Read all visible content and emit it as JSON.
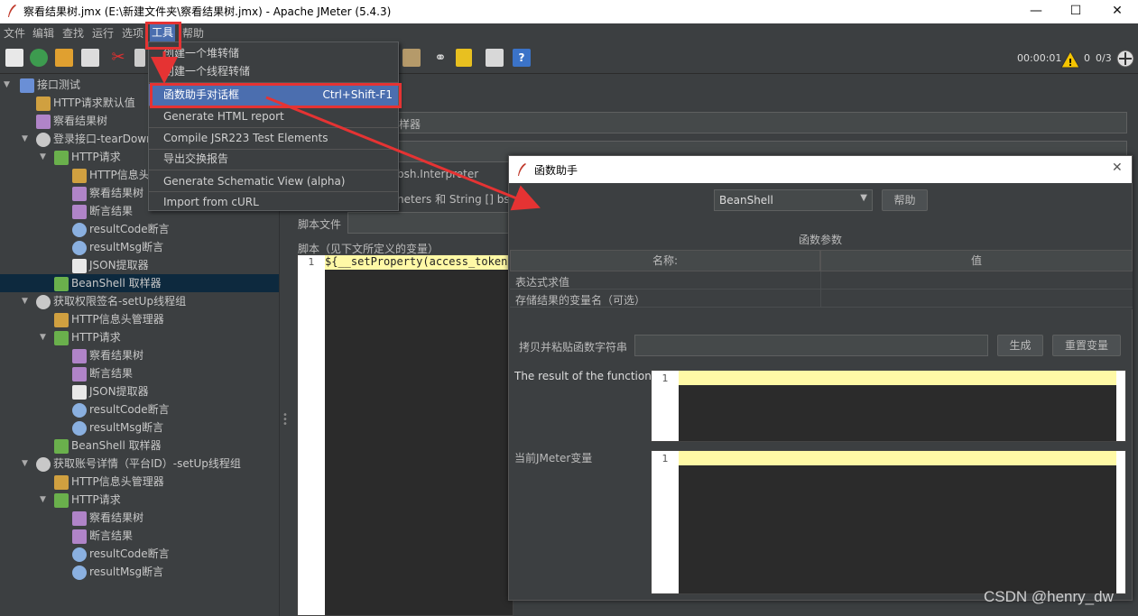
{
  "window": {
    "title": "察看结果树.jmx (E:\\新建文件夹\\察看结果树.jmx) - Apache JMeter (5.4.3)",
    "min_glyph": "—",
    "max_glyph": "☐",
    "close_glyph": "✕"
  },
  "menubar": [
    "文件",
    "编辑",
    "查找",
    "运行",
    "选项",
    "工具",
    "帮助"
  ],
  "toolbar": {
    "timer": "00:00:01",
    "warn_count": "0",
    "threads": "0/3"
  },
  "tree": [
    {
      "label": "接口测试"
    },
    {
      "label": "HTTP请求默认值"
    },
    {
      "label": "察看结果树"
    },
    {
      "label": "登录接口-tearDown"
    },
    {
      "label": "HTTP请求"
    },
    {
      "label": "HTTP信息头"
    },
    {
      "label": "察看结果树"
    },
    {
      "label": "断言结果"
    },
    {
      "label": "resultCode断言"
    },
    {
      "label": "resultMsg断言"
    },
    {
      "label": "JSON提取器"
    },
    {
      "label": "BeanShell 取样器"
    },
    {
      "label": "获取权限签名-setUp线程组"
    },
    {
      "label": "HTTP信息头管理器"
    },
    {
      "label": "HTTP请求"
    },
    {
      "label": "察看结果树"
    },
    {
      "label": "断言结果"
    },
    {
      "label": "JSON提取器"
    },
    {
      "label": "resultCode断言"
    },
    {
      "label": "resultMsg断言"
    },
    {
      "label": "BeanShell 取样器"
    },
    {
      "label": "获取账号详情（平台ID）-setUp线程组"
    },
    {
      "label": "HTTP信息头管理器"
    },
    {
      "label": "HTTP请求"
    },
    {
      "label": "察看结果树"
    },
    {
      "label": "断言结果"
    },
    {
      "label": "resultCode断言"
    },
    {
      "label": "resultMsg断言"
    }
  ],
  "tools_menu": [
    {
      "label": "创建一个堆转储",
      "shortcut": ""
    },
    {
      "label": "创建一个线程转储",
      "shortcut": ""
    },
    {
      "label": "函数助手对话框",
      "shortcut": "Ctrl+Shift-F1"
    },
    {
      "label": "Generate HTML report",
      "shortcut": ""
    },
    {
      "label": "Compile JSR223 Test Elements",
      "shortcut": ""
    },
    {
      "label": "导出交换报告",
      "shortcut": ""
    },
    {
      "label": "Generate Schematic View (alpha)",
      "shortcut": ""
    },
    {
      "label": "Import from cURL",
      "shortcut": ""
    }
  ],
  "background_panel": {
    "sampler_fragment": "样器",
    "interpreter_fragment": "bsh.Interpreter",
    "params_fragment": "neters 和 String [] bsh.",
    "script_file_label": "脚本文件",
    "script_label": "脚本（见下文所定义的变量）",
    "code_line": "${__setProperty(access_token,",
    "line_no": "1"
  },
  "dialog": {
    "title": "函数助手",
    "function_select": "BeanShell",
    "help_button": "帮助",
    "params_header": "函数参数",
    "col_name": "名称:",
    "col_value": "值",
    "rows": [
      {
        "name": "表达式求值",
        "value": ""
      },
      {
        "name": "存储结果的变量名（可选）",
        "value": ""
      }
    ],
    "copy_label": "拷贝并粘贴函数字符串",
    "generate_button": "生成",
    "reset_button": "重置变量",
    "result_label": "The result of the function is",
    "current_vars_label": "当前JMeter变量",
    "line_no": "1"
  },
  "watermark": "CSDN @henry_dw",
  "colors": {
    "bg": "#3c3f41",
    "accent": "#4b6eaf",
    "annotation": "#e53333",
    "highlight_line": "#fff9a6"
  }
}
